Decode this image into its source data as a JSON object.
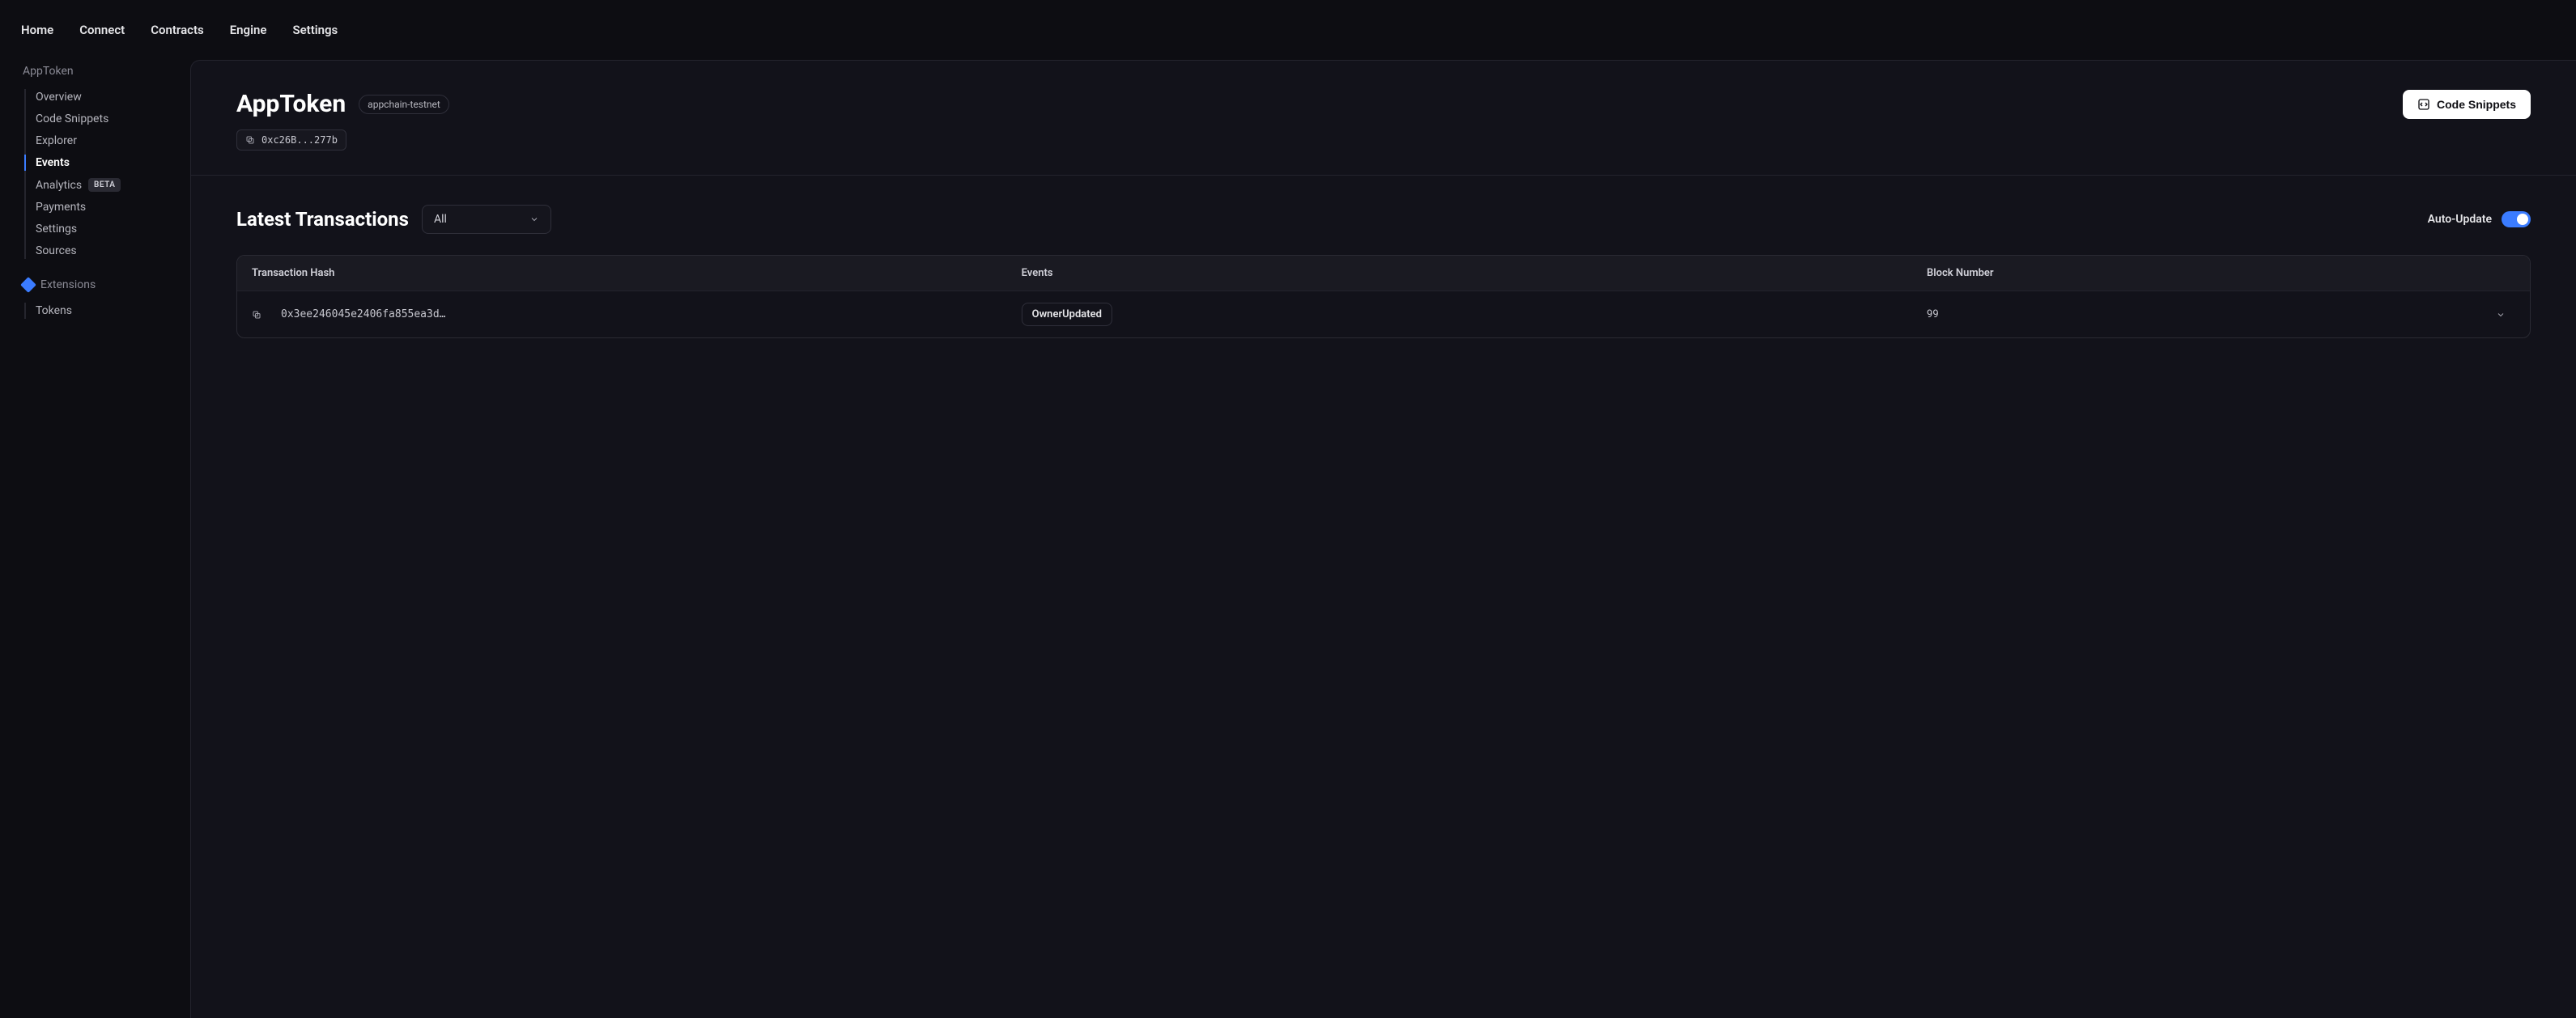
{
  "topnav": {
    "items": [
      "Home",
      "Connect",
      "Contracts",
      "Engine",
      "Settings"
    ]
  },
  "sidebar": {
    "heading": "AppToken",
    "items": [
      {
        "label": "Overview"
      },
      {
        "label": "Code Snippets"
      },
      {
        "label": "Explorer"
      },
      {
        "label": "Events",
        "active": true
      },
      {
        "label": "Analytics",
        "badge": "BETA"
      },
      {
        "label": "Payments"
      },
      {
        "label": "Settings"
      },
      {
        "label": "Sources"
      }
    ],
    "ext_heading": "Extensions",
    "ext_items": [
      {
        "label": "Tokens"
      }
    ]
  },
  "header": {
    "title": "AppToken",
    "chain": "appchain-testnet",
    "address": "0xc26B...277b",
    "code_snippets_btn": "Code Snippets"
  },
  "events": {
    "section_title": "Latest Transactions",
    "filter_value": "All",
    "auto_update_label": "Auto-Update",
    "columns": {
      "hash": "Transaction Hash",
      "events": "Events",
      "block": "Block Number"
    },
    "rows": [
      {
        "hash": "0x3ee246045e2406fa855ea3d…",
        "event": "OwnerUpdated",
        "block": "99"
      }
    ]
  }
}
